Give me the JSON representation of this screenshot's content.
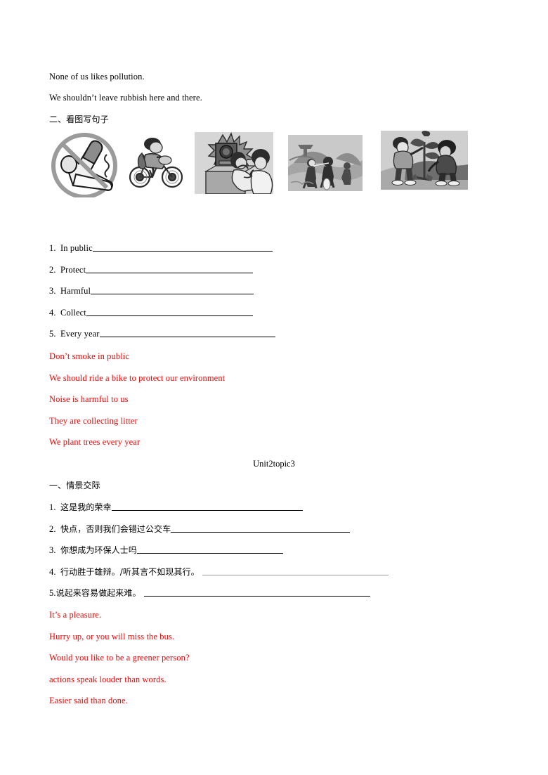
{
  "document": {
    "intro_lines": [
      "None of us likes pollution.",
      "We shouldn’t leave rubbish here and there."
    ],
    "section_two_heading": "二、看图写句子",
    "pictures": [
      {
        "name": "no-smoking-sign",
        "alt": "A crossed-out bent cigarette inside a circle"
      },
      {
        "name": "boy-riding-bicycle",
        "alt": "A boy riding a bicycle"
      },
      {
        "name": "loud-speaker-noise",
        "alt": "A loud speaker with children covering their ears"
      },
      {
        "name": "children-collecting-litter",
        "alt": "Children collecting litter in a park"
      },
      {
        "name": "children-planting-tree",
        "alt": "Two children planting a tree"
      }
    ],
    "picture_prompts": [
      {
        "num": "1.",
        "prompt": "In public",
        "blank_width": 256
      },
      {
        "num": "2.",
        "prompt": "Protect",
        "blank_width": 238
      },
      {
        "num": "3.",
        "prompt": "Harmful",
        "blank_width": 232
      },
      {
        "num": "4.",
        "prompt": "Collect",
        "blank_width": 237
      },
      {
        "num": "5.",
        "prompt": "Every year",
        "blank_width": 250
      }
    ],
    "picture_answers": [
      "Don’t smoke in public",
      "We should ride a bike to protect our environment",
      "Noise is harmful to us",
      "They are collecting litter",
      "We plant trees every year"
    ],
    "unit_title": "Unit2topic3",
    "section_one_heading": "一、情景交际",
    "translation_prompts": [
      {
        "num": "1.",
        "prompt": "这是我的荣幸",
        "blank_width": 272,
        "gray": false
      },
      {
        "num": "2.",
        "prompt": "快点，否则我们会错过公交车",
        "blank_width": 255,
        "gray": false
      },
      {
        "num": "3.",
        "prompt": "你想成为环保人士吗",
        "blank_width": 208,
        "gray": false
      },
      {
        "num": "4.",
        "prompt": "行动胜于雄辩。/听其言不如现其行。 ",
        "blank_width": 265,
        "gray": true
      },
      {
        "num": "5.",
        "prompt": "说起来容易做起来难。 ",
        "blank_width": 322,
        "gray": false
      }
    ],
    "translation_answers": [
      "It’s a pleasure.",
      "Hurry up, or you will miss the bus.",
      "Would you like to be a greener person?",
      "actions speak louder than words.",
      "Easier said than done."
    ]
  },
  "colors": {
    "answer_red": "#ff0000",
    "text_black": "#000000",
    "rule_gray": "#9a9a9a"
  }
}
